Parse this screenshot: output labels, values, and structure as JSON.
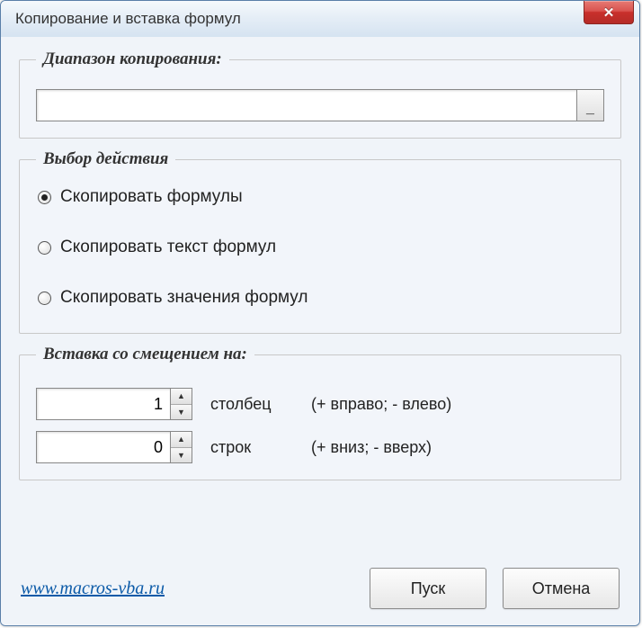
{
  "window": {
    "title": "Копирование и вставка формул"
  },
  "group_range": {
    "legend": "Диапазон копирования:",
    "value": "",
    "picker_glyph": "_"
  },
  "group_action": {
    "legend": "Выбор действия",
    "options": [
      {
        "label": "Скопировать формулы",
        "selected": true
      },
      {
        "label": "Скопировать текст формул",
        "selected": false
      },
      {
        "label": "Скопировать значения формул",
        "selected": false
      }
    ]
  },
  "group_offset": {
    "legend": "Вставка со смещением на:",
    "col": {
      "value": "1",
      "label": "столбец",
      "hint": "(+ вправо; - влево)"
    },
    "row": {
      "value": "0",
      "label": "строк",
      "hint": "(+ вниз; - вверх)"
    }
  },
  "footer": {
    "link": "www.macros-vba.ru",
    "run": "Пуск",
    "cancel": "Отмена"
  }
}
